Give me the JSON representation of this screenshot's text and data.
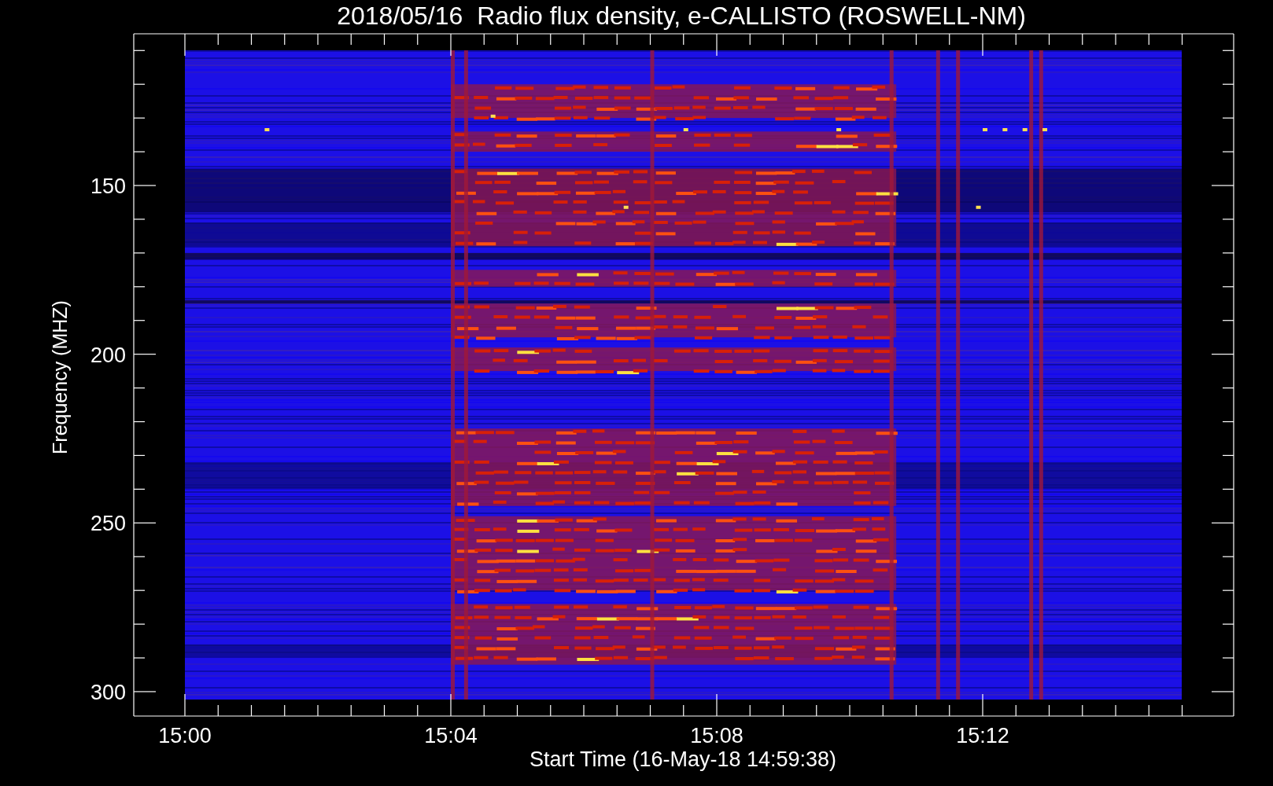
{
  "title": "2018/05/16  Radio flux density, e-CALLISTO (ROSWELL-NM)",
  "y_axis": {
    "label": "Frequency (MHZ)",
    "ticks": [
      "150",
      "200",
      "250",
      "300"
    ]
  },
  "x_axis": {
    "label": "Start Time (16-May-18 14:59:38)",
    "ticks": [
      "15:00",
      "15:04",
      "15:08",
      "15:12"
    ]
  }
}
